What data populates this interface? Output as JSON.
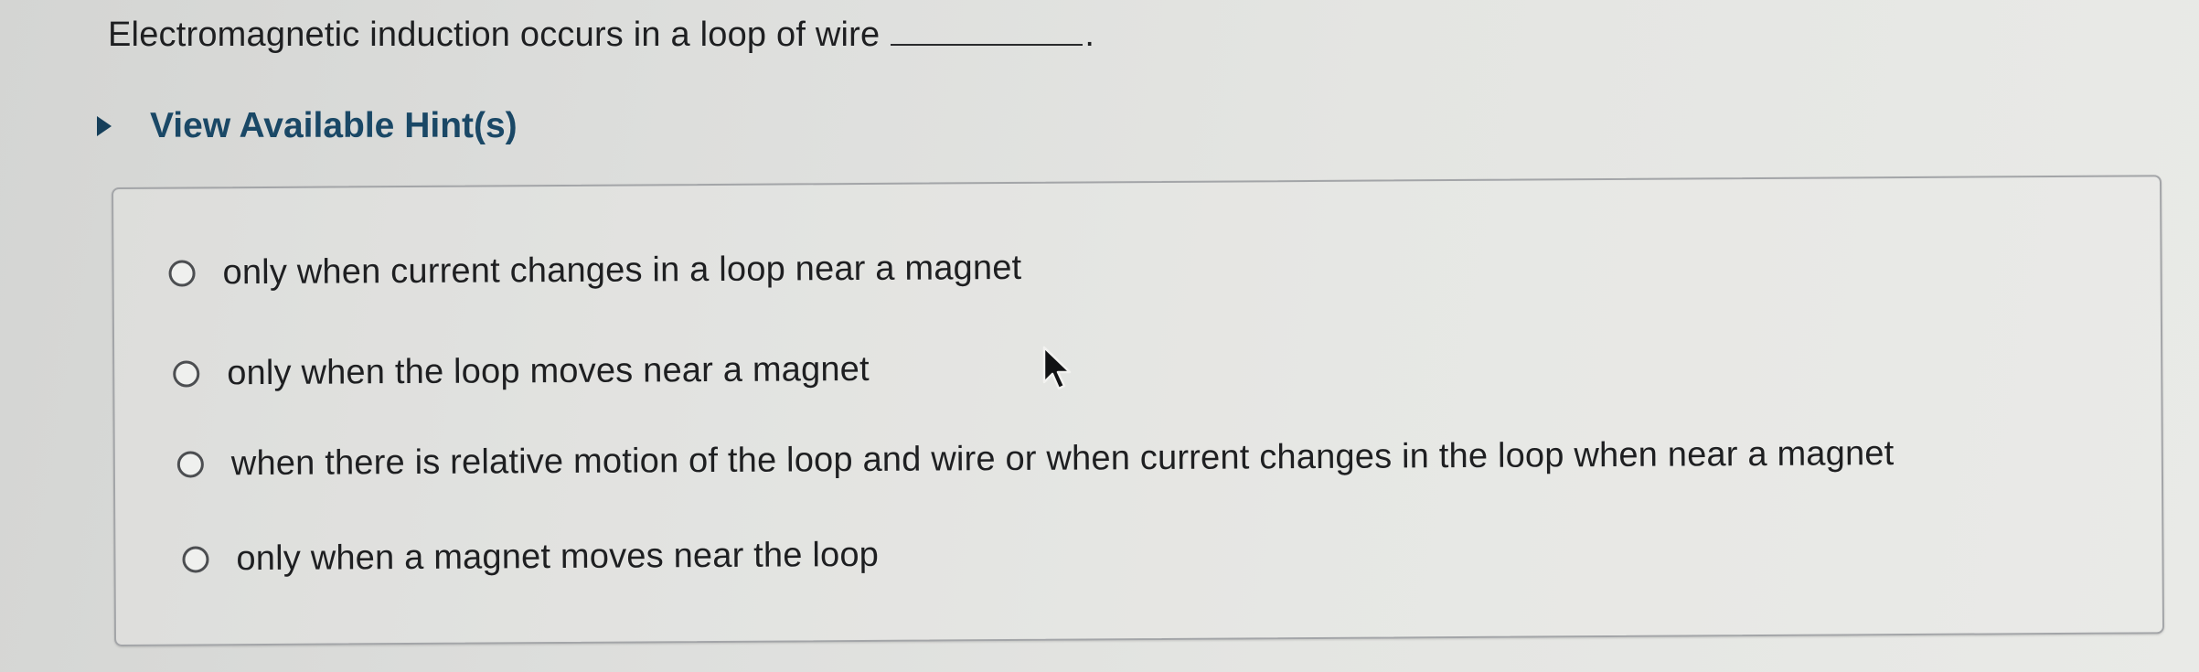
{
  "question": {
    "text": "Electromagnetic induction occurs in a loop of wire",
    "blank_suffix": "."
  },
  "hints": {
    "label": "View Available Hint(s)",
    "expanded": false
  },
  "options": [
    {
      "label": "only when current changes in a loop near a magnet",
      "selected": false
    },
    {
      "label": "only when the loop moves near a magnet",
      "selected": false
    },
    {
      "label": "when there is relative motion of the loop and wire or when current changes in the loop when near a magnet",
      "selected": false
    },
    {
      "label": "only when a magnet moves near the loop",
      "selected": false
    }
  ],
  "colors": {
    "hint_link": "#1a4866",
    "text": "#1e1f21",
    "box_border": "#a3a5a8"
  },
  "icons": {
    "hint_toggle": "caret-right-icon",
    "cursor": "mouse-pointer-icon",
    "option_marker": "radio-button"
  }
}
